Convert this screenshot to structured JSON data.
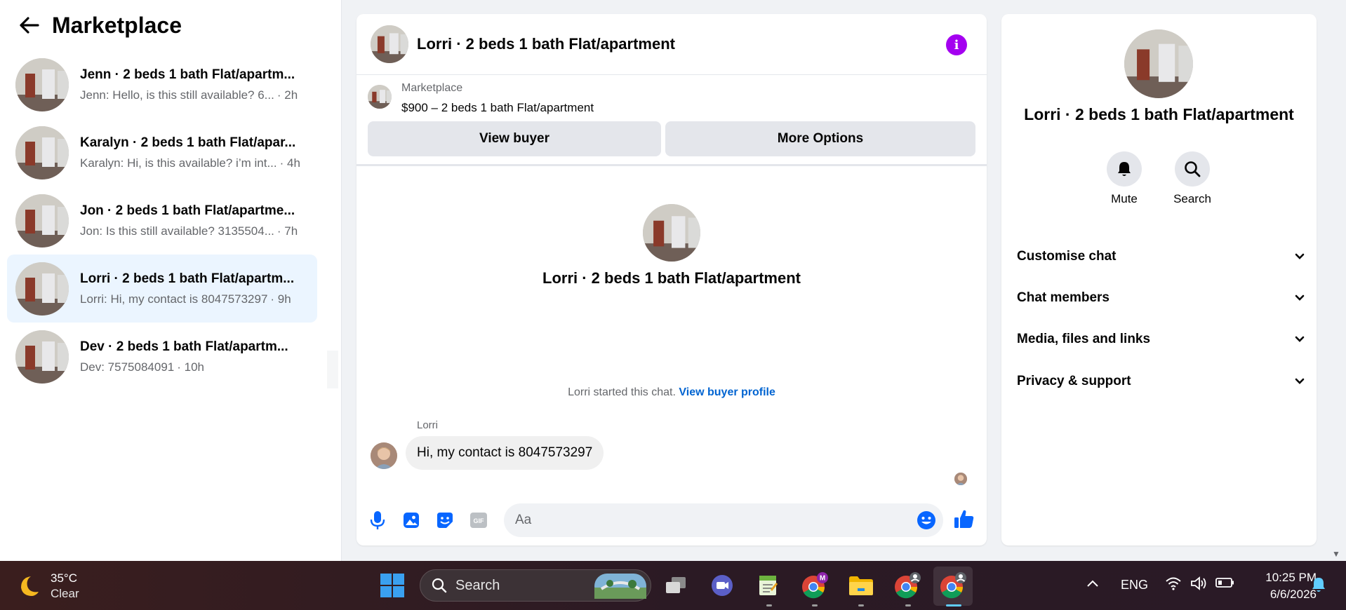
{
  "sidebar": {
    "title": "Marketplace",
    "conversations": [
      {
        "title": "Jenn · 2 beds 1 bath Flat/apartm...",
        "snippet": "Jenn: Hello, is this still available? 6...",
        "time": "· 2h",
        "active": false
      },
      {
        "title": "Karalyn · 2 beds 1 bath Flat/apar...",
        "snippet": "Karalyn: Hi, is this available? i’m int...",
        "time": "· 4h",
        "active": false
      },
      {
        "title": "Jon · 2 beds 1 bath Flat/apartme...",
        "snippet": "Jon: Is this still available? 3135504...",
        "time": "· 7h",
        "active": false
      },
      {
        "title": "Lorri · 2 beds 1 bath Flat/apartm...",
        "snippet": "Lorri: Hi, my contact is 8047573297",
        "time": "· 9h",
        "active": true
      },
      {
        "title": "Dev · 2 beds 1 bath Flat/apartm...",
        "snippet": "Dev: 7575084091",
        "time": "· 10h",
        "active": false
      }
    ]
  },
  "chat": {
    "header_name": "Lorri · 2 beds 1 bath Flat/apartment",
    "marketplace_label": "Marketplace",
    "listing": "$900 – 2 beds 1 bath Flat/apartment",
    "view_buyer": "View buyer",
    "more_options": "More Options",
    "center_name": "Lorri · 2 beds 1 bath Flat/apartment",
    "started_text": "Lorri started this chat.",
    "view_profile": "View buyer profile",
    "sender": "Lorri",
    "message": "Hi, my contact is 8047573297",
    "input_placeholder": "Aa"
  },
  "info_panel": {
    "name": "Lorri · 2 beds 1 bath Flat/apartment",
    "mute": "Mute",
    "search": "Search",
    "sections": [
      "Customise chat",
      "Chat members",
      "Media, files and links",
      "Privacy & support"
    ]
  },
  "taskbar": {
    "temperature": "35°C",
    "condition": "Clear",
    "search": "Search",
    "language": "ENG",
    "time": "10:25 PM",
    "date": "6/6/2026"
  },
  "colors": {
    "accent": "#0866ff",
    "info_button": "#a400f0",
    "active_conversation": "#ebf5ff"
  }
}
